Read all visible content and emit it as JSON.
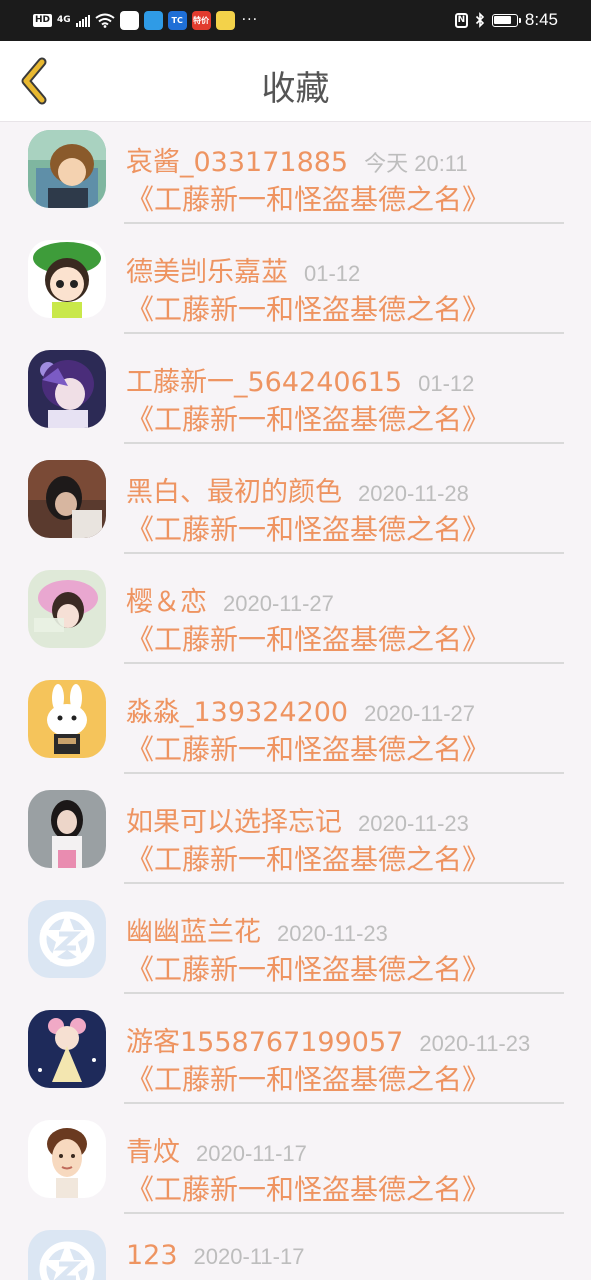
{
  "status_bar": {
    "hd": "HD",
    "network": "4G",
    "app_icons": [
      {
        "icon": "teddy-app-icon",
        "text": "",
        "color": "#ffffff"
      },
      {
        "icon": "browser-app-icon",
        "text": "",
        "color": "#2f9be6"
      },
      {
        "icon": "tc-app-icon",
        "text": "TC",
        "color": "#1f6fd6"
      },
      {
        "icon": "news-app-icon",
        "text": "特价",
        "color": "#e23b2e"
      },
      {
        "icon": "emoji-app-icon",
        "text": "",
        "color": "#f3d24a"
      }
    ],
    "more": "···",
    "nfc": "N",
    "time": "8:45"
  },
  "header": {
    "title": "收藏",
    "back_color": "#e8b830"
  },
  "colors": {
    "accent": "#ee9461",
    "timestamp": "#bdbdbd",
    "divider": "#d9d9d9"
  },
  "items": [
    {
      "name": "哀酱_033171885",
      "time": "今天 20:11",
      "title": "《工藤新一和怪盗基德之名》",
      "avatar": "anime-boy-avatar"
    },
    {
      "name": "德美剀乐嘉莁",
      "time": "01-12",
      "title": "《工藤新一和怪盗基德之名》",
      "avatar": "green-hat-girl-avatar"
    },
    {
      "name": "工藤新一_564240615",
      "time": "01-12",
      "title": "《工藤新一和怪盗基德之名》",
      "avatar": "purple-hair-anime-avatar"
    },
    {
      "name": "黑白、最初的颜色",
      "time": "2020-11-28",
      "title": "《工藤新一和怪盗基德之名》",
      "avatar": "dark-photo-avatar"
    },
    {
      "name": "樱＆恋",
      "time": "2020-11-27",
      "title": "《工藤新一和怪盗基德之名》",
      "avatar": "pink-girl-avatar"
    },
    {
      "name": "淼淼_139324200",
      "time": "2020-11-27",
      "title": "《工藤新一和怪盗基德之名》",
      "avatar": "bunny-avatar"
    },
    {
      "name": "如果可以选择忘记",
      "time": "2020-11-23",
      "title": "《工藤新一和怪盗基德之名》",
      "avatar": "girl-photo-avatar"
    },
    {
      "name": "幽幽蓝兰花",
      "time": "2020-11-23",
      "title": "《工藤新一和怪盗基德之名》",
      "avatar": "default-star-avatar"
    },
    {
      "name": "游客1558767199057",
      "time": "2020-11-23",
      "title": "《工藤新一和怪盗基德之名》",
      "avatar": "doll-avatar"
    },
    {
      "name": "青炆",
      "time": "2020-11-17",
      "title": "《工藤新一和怪盗基德之名》",
      "avatar": "cartoon-boy-avatar"
    },
    {
      "name": "123",
      "time": "2020-11-17",
      "title": "",
      "avatar": "default-star-avatar"
    }
  ]
}
